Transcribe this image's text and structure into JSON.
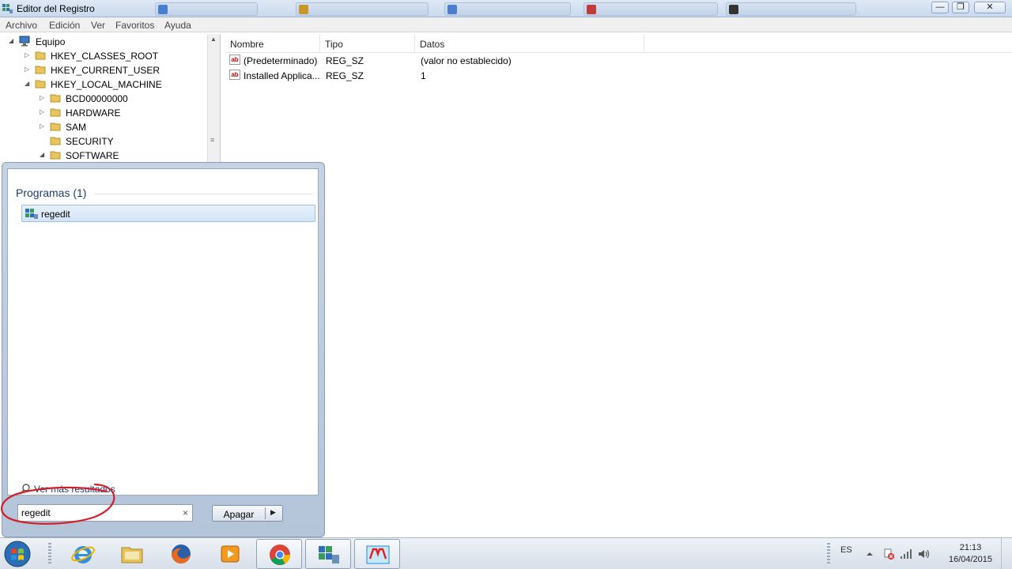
{
  "window": {
    "title": "Editor del Registro",
    "controls": {
      "minimize": "—",
      "restore": "❐",
      "close": "✕"
    }
  },
  "menu": [
    "Archivo",
    "Edición",
    "Ver",
    "Favoritos",
    "Ayuda"
  ],
  "tree": {
    "root": "Equipo",
    "items": [
      {
        "label": "HKEY_CLASSES_ROOT"
      },
      {
        "label": "HKEY_CURRENT_USER"
      },
      {
        "label": "HKEY_LOCAL_MACHINE"
      },
      {
        "label": "BCD00000000"
      },
      {
        "label": "HARDWARE"
      },
      {
        "label": "SAM"
      },
      {
        "label": "SECURITY"
      },
      {
        "label": "SOFTWARE"
      }
    ]
  },
  "list": {
    "columns": [
      "Nombre",
      "Tipo",
      "Datos"
    ],
    "rows": [
      {
        "name": "(Predeterminado)",
        "type": "REG_SZ",
        "data": "(valor no establecido)"
      },
      {
        "name": "Installed Applica...",
        "type": "REG_SZ",
        "data": "1"
      }
    ]
  },
  "start_menu": {
    "section_title": "Programas (1)",
    "result": "regedit",
    "more_results": "Ver más resultados",
    "search_value": "regedit",
    "search_clear": "×",
    "shutdown_label": "Apagar",
    "shutdown_arrow": "▶"
  },
  "taskbar": {
    "language": "ES",
    "time": "21:13",
    "date": "16/04/2015"
  },
  "colors": {
    "highlight_circle": "#d0202a",
    "selection_bg": "#d3e4f7",
    "programs_title": "#1e3a6e"
  }
}
